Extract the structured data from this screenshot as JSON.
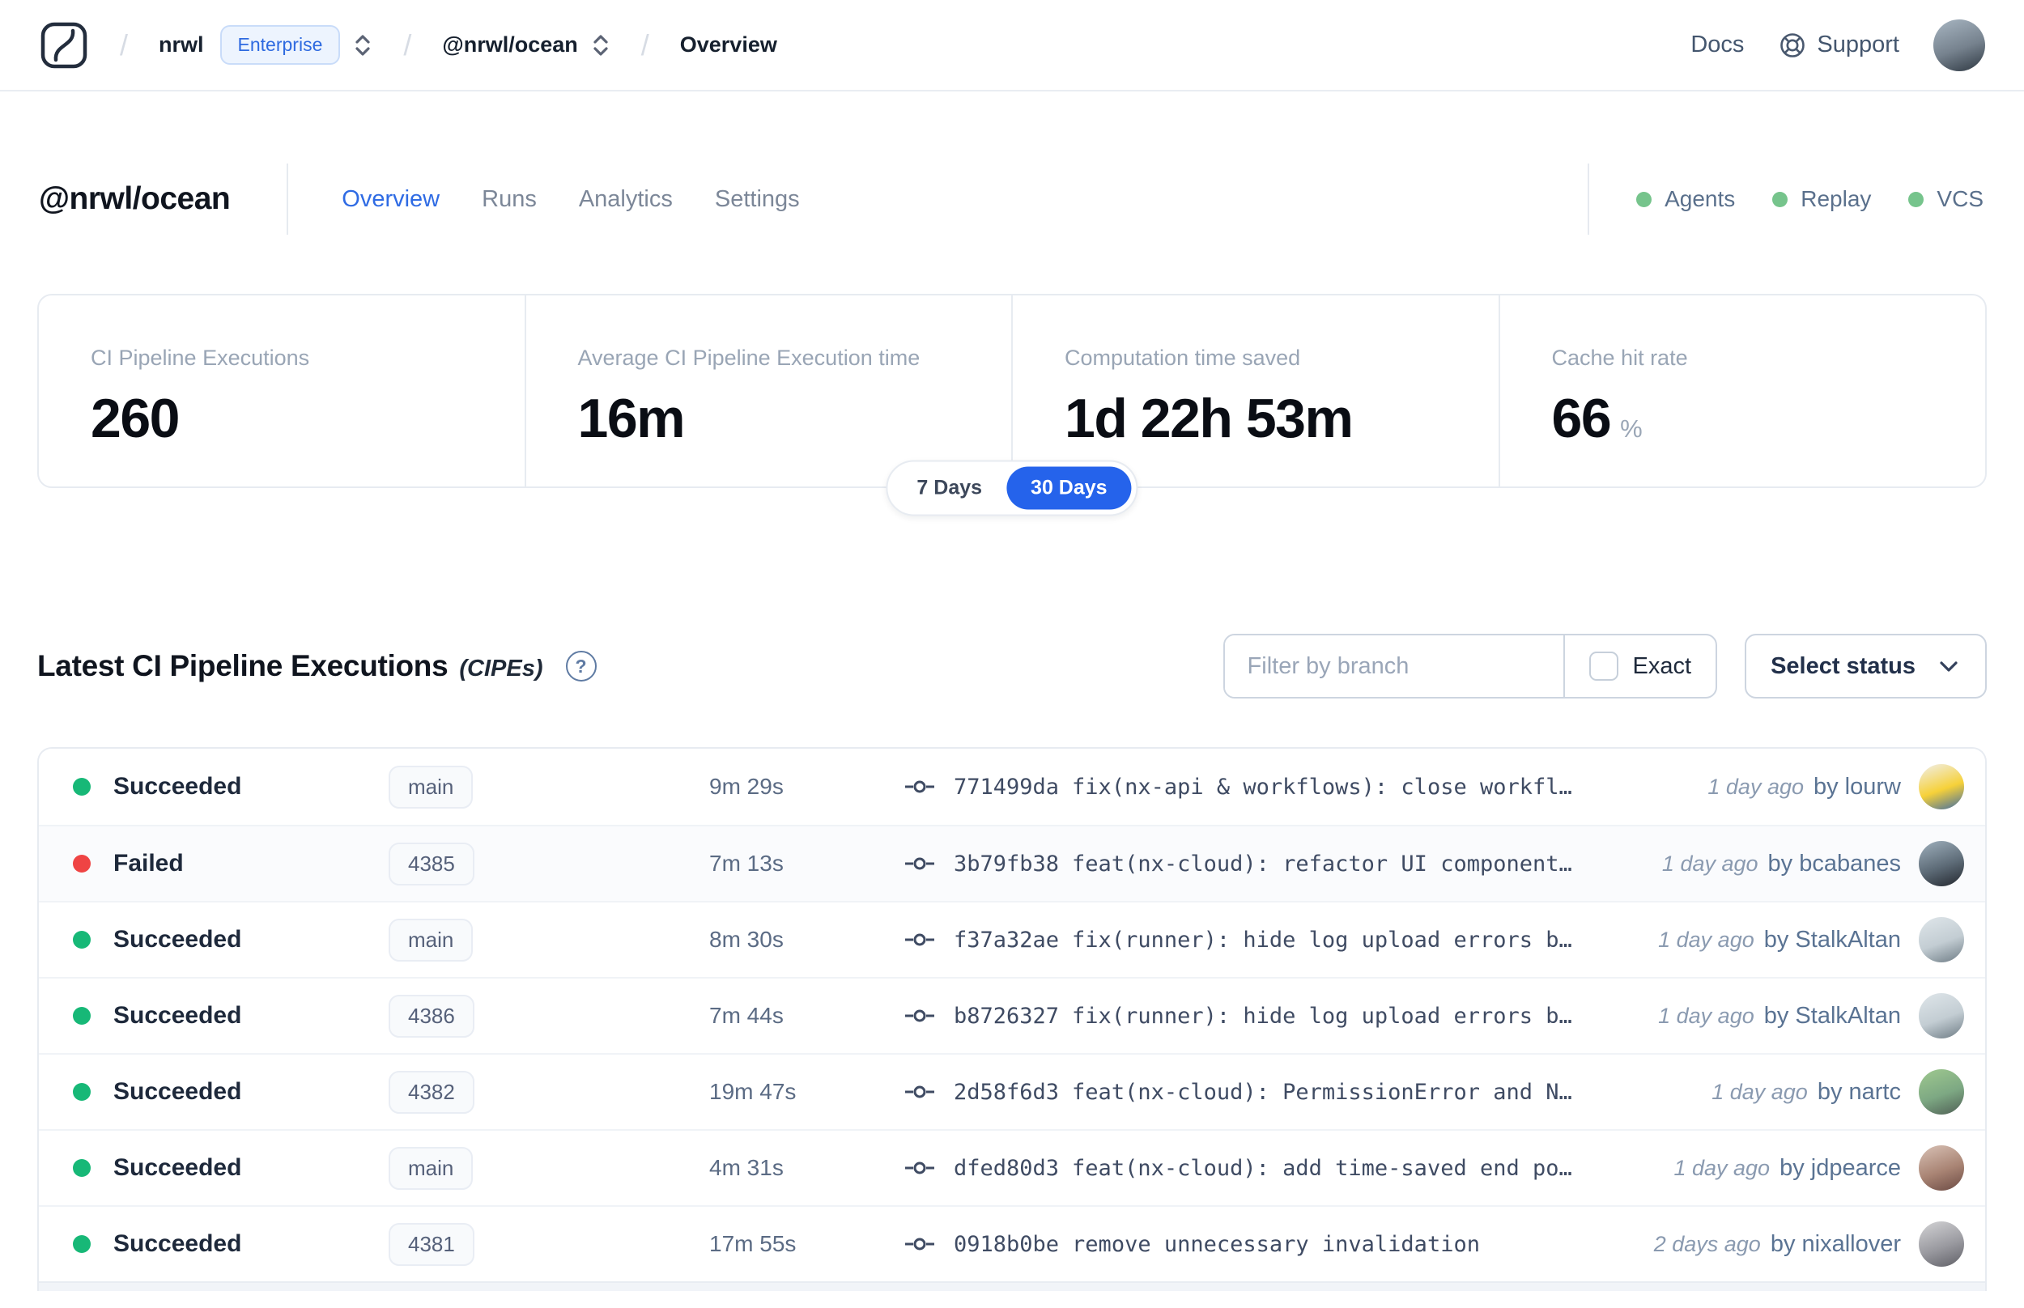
{
  "navbar": {
    "org": "nrwl",
    "org_badge": "Enterprise",
    "workspace": "@nrwl/ocean",
    "page": "Overview",
    "docs_label": "Docs",
    "support_label": "Support"
  },
  "header": {
    "title": "@nrwl/ocean",
    "tabs": [
      {
        "label": "Overview",
        "active": true
      },
      {
        "label": "Runs",
        "active": false
      },
      {
        "label": "Analytics",
        "active": false
      },
      {
        "label": "Settings",
        "active": false
      }
    ],
    "indicators": [
      {
        "label": "Agents"
      },
      {
        "label": "Replay"
      },
      {
        "label": "VCS"
      }
    ]
  },
  "stats": {
    "cards": [
      {
        "label": "CI Pipeline Executions",
        "value": "260",
        "suffix": ""
      },
      {
        "label": "Average CI Pipeline Execution time",
        "value": "16m",
        "suffix": ""
      },
      {
        "label": "Computation time saved",
        "value": "1d 22h 53m",
        "suffix": ""
      },
      {
        "label": "Cache hit rate",
        "value": "66",
        "suffix": "%"
      }
    ],
    "period_toggle": {
      "options": [
        "7 Days",
        "30 Days"
      ],
      "selected": "30 Days"
    }
  },
  "executions": {
    "title": "Latest CI Pipeline Executions",
    "subtitle": "(CIPEs)",
    "filter_placeholder": "Filter by branch",
    "exact_label": "Exact",
    "status_select_label": "Select status",
    "rows": [
      {
        "status": "Succeeded",
        "branch": "main",
        "duration": "9m 29s",
        "commit": "771499da",
        "message": "fix(nx-api & workflows): close workfl…",
        "time": "1 day ago",
        "author": "by lourw",
        "avatar_colors": [
          "#f0efed",
          "#f6d139",
          "#3e6ba5"
        ]
      },
      {
        "status": "Failed",
        "branch": "4385",
        "duration": "7m 13s",
        "commit": "3b79fb38",
        "message": "feat(nx-cloud): refactor UI component…",
        "time": "1 day ago",
        "author": "by bcabanes",
        "avatar_colors": [
          "#9fb0bd",
          "#5d6b77",
          "#23272e"
        ]
      },
      {
        "status": "Succeeded",
        "branch": "main",
        "duration": "8m 30s",
        "commit": "f37a32ae",
        "message": "fix(runner): hide log upload errors b…",
        "time": "1 day ago",
        "author": "by StalkAltan",
        "avatar_colors": [
          "#dfe6ea",
          "#c3cdd3",
          "#6d7b84"
        ]
      },
      {
        "status": "Succeeded",
        "branch": "4386",
        "duration": "7m 44s",
        "commit": "b8726327",
        "message": "fix(runner): hide log upload errors b…",
        "time": "1 day ago",
        "author": "by StalkAltan",
        "avatar_colors": [
          "#dfe6ea",
          "#c3cdd3",
          "#6d7b84"
        ]
      },
      {
        "status": "Succeeded",
        "branch": "4382",
        "duration": "19m 47s",
        "commit": "2d58f6d3",
        "message": "feat(nx-cloud): PermissionError and N…",
        "time": "1 day ago",
        "author": "by nartc",
        "avatar_colors": [
          "#9fc98f",
          "#7da883",
          "#4f5f55"
        ]
      },
      {
        "status": "Succeeded",
        "branch": "main",
        "duration": "4m 31s",
        "commit": "dfed80d3",
        "message": "feat(nx-cloud): add time-saved end po…",
        "time": "1 day ago",
        "author": "by jdpearce",
        "avatar_colors": [
          "#d9c2b6",
          "#a98474",
          "#6b4a43"
        ]
      },
      {
        "status": "Succeeded",
        "branch": "4381",
        "duration": "17m 55s",
        "commit": "0918b0be",
        "message": "remove unnecessary invalidation",
        "time": "2 days ago",
        "author": "by nixallover",
        "avatar_colors": [
          "#d4d4d6",
          "#9a9aa0",
          "#5f5f66"
        ]
      }
    ]
  },
  "colors": {
    "succeeded": "#17b877",
    "failed": "#ef4444",
    "accent": "#2563eb",
    "indicator_green": "#76c48c",
    "nav_avatar": [
      "#a8b6c2",
      "#76828e",
      "#2e3842"
    ]
  }
}
